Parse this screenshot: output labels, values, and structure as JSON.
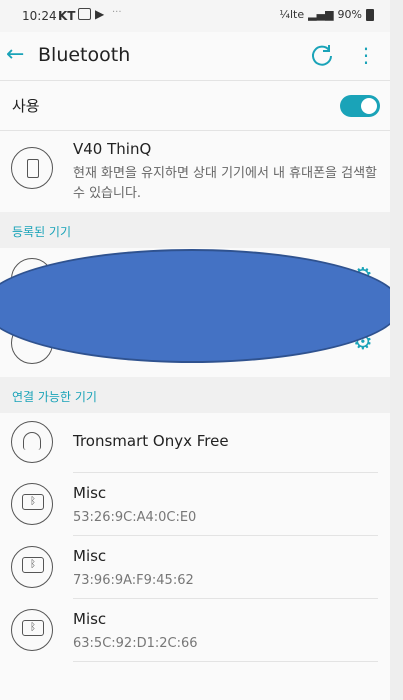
{
  "status_bar": {
    "time": "10:24",
    "carrier": "KT",
    "network": "¼lte",
    "battery": "90%"
  },
  "toolbar": {
    "back_icon": "arrow-left-icon",
    "title": "Bluetooth",
    "refresh_icon": "refresh-icon",
    "more_icon": "more-vert-icon"
  },
  "bluetooth_toggle": {
    "label": "사용",
    "enabled": true
  },
  "this_device": {
    "name": "V40 ThinQ",
    "description": "현재 화면을 유지하면 상대 기기에서 내 휴대폰을 검색할 수 있습니다."
  },
  "sections": {
    "paired_label": "등록된 기기",
    "available_label": "연결 가능한 기기"
  },
  "available_devices": [
    {
      "name": "Tronsmart Onyx Free",
      "address": "",
      "icon": "headset-icon"
    },
    {
      "name": "Misc",
      "address": "53:26:9C:A4:0C:E0",
      "icon": "bluetooth-device-icon"
    },
    {
      "name": "Misc",
      "address": "73:96:9A:F9:45:62",
      "icon": "bluetooth-device-icon"
    },
    {
      "name": "Misc",
      "address": "63:5C:92:D1:2C:66",
      "icon": "bluetooth-device-icon"
    }
  ],
  "colors": {
    "accent": "#1aa3b8",
    "redaction": "#4472c4"
  }
}
